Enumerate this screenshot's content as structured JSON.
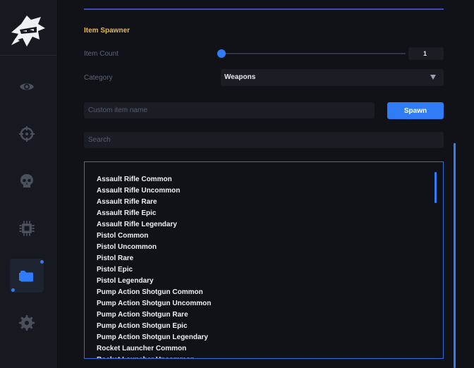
{
  "section_title": "Item Spawner",
  "item_count": {
    "label": "Item Count",
    "value": "1",
    "slider_fraction": 0
  },
  "category": {
    "label": "Category",
    "selected": "Weapons"
  },
  "custom_name": {
    "placeholder": "Custom item name",
    "value": ""
  },
  "spawn_button": "Spawn",
  "search": {
    "placeholder": "Search",
    "value": ""
  },
  "items": [
    "Assault Rifle Common",
    "Assault Rifle Uncommon",
    "Assault Rifle Rare",
    "Assault Rifle Epic",
    "Assault Rifle Legendary",
    "Pistol Common",
    "Pistol Uncommon",
    "Pistol Rare",
    "Pistol Epic",
    "Pistol Legendary",
    "Pump Action Shotgun Common",
    "Pump Action Shotgun Uncommon",
    "Pump Action Shotgun Rare",
    "Pump Action Shotgun Epic",
    "Pump Action Shotgun Legendary",
    "Rocket Launcher Common",
    "Rocket Launcher Uncommon"
  ],
  "sidebar": {
    "items": [
      {
        "icon": "eye-icon",
        "active": false
      },
      {
        "icon": "crosshair-icon",
        "active": false
      },
      {
        "icon": "skull-icon",
        "active": false
      },
      {
        "icon": "chip-icon",
        "active": false
      },
      {
        "icon": "folder-icon",
        "active": true
      },
      {
        "icon": "gear-icon",
        "active": false
      }
    ]
  },
  "colors": {
    "accent": "#2f7cf6",
    "title": "#e9b949",
    "background": "#101217",
    "sidebar": "#16191f"
  }
}
